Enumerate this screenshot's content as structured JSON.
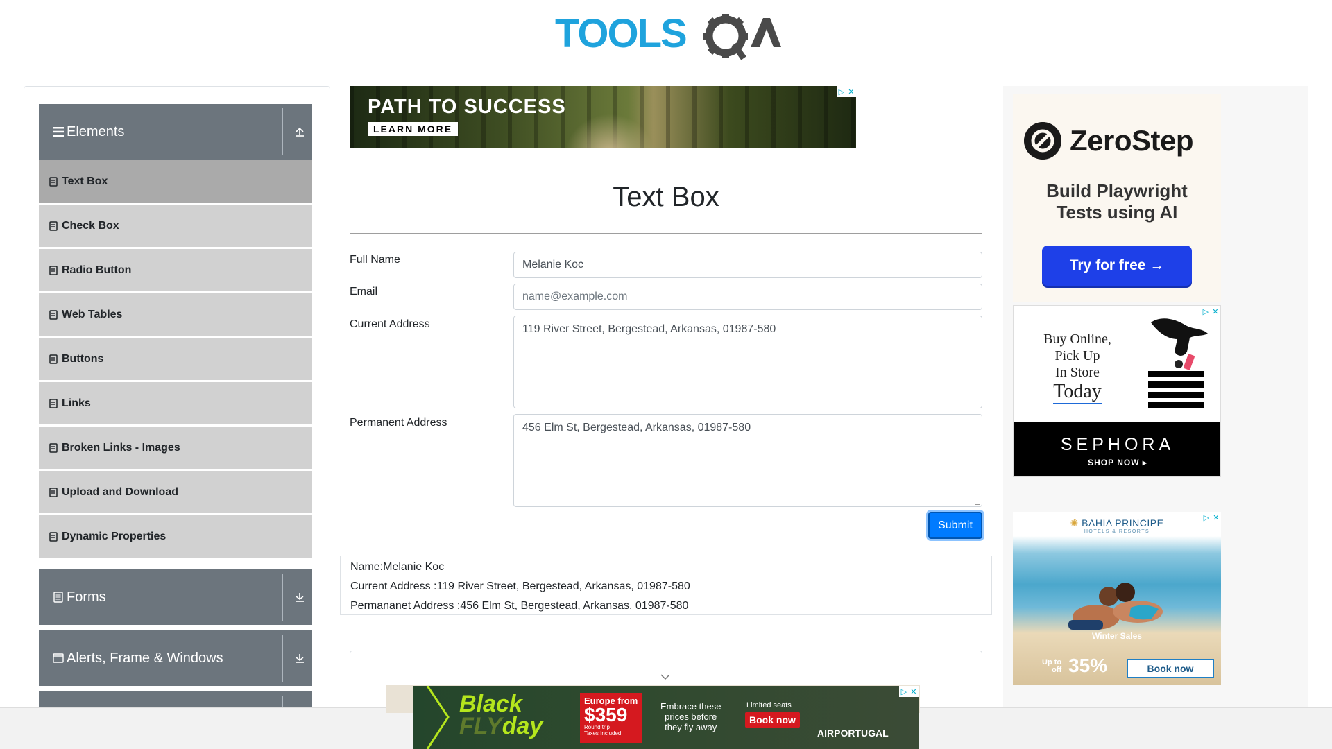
{
  "header": {
    "logo_tools": "TOOLS",
    "logo_qa": "QA"
  },
  "sidebar": {
    "groups": [
      {
        "title": "Elements",
        "icon": "hamburger-icon",
        "expanded": true
      },
      {
        "title": "Forms",
        "icon": "document-icon",
        "expanded": false
      },
      {
        "title": "Alerts, Frame & Windows",
        "icon": "window-icon",
        "expanded": false
      }
    ],
    "items": [
      {
        "label": "Text Box",
        "active": true
      },
      {
        "label": "Check Box"
      },
      {
        "label": "Radio Button"
      },
      {
        "label": "Web Tables"
      },
      {
        "label": "Buttons"
      },
      {
        "label": "Links"
      },
      {
        "label": "Broken Links - Images"
      },
      {
        "label": "Upload and Download"
      },
      {
        "label": "Dynamic Properties"
      }
    ]
  },
  "ads": {
    "top": {
      "title": "PATH TO SUCCESS",
      "button": "LEARN MORE"
    },
    "zerostep": {
      "brand": "ZeroStep",
      "tagline_1": "Build Playwright",
      "tagline_2": "Tests using AI",
      "cta": "Try for free →"
    },
    "sephora": {
      "line1": "Buy Online,",
      "line2": "Pick Up",
      "line3": "In Store",
      "line4": "Today",
      "brand": "SEPHORA",
      "cta": "SHOP NOW ▸"
    },
    "bahia": {
      "brand": "BAHIA PRINCIPE",
      "sub": "HOTELS & RESORTS",
      "sale": "Winter Sales",
      "upto_1": "Up to",
      "upto_2": "off",
      "pct": "35%",
      "cta": "Book now"
    },
    "bottom": {
      "black": "Black",
      "fly": "FLY",
      "day": "day",
      "price_from": "Europe from",
      "price": "$359",
      "price_note": "Round trip",
      "price_note_2": "Taxes Included",
      "msg_1": "Embrace these",
      "msg_2": "prices before",
      "msg_3": "they fly away",
      "limited": "Limited seats",
      "book": "Book now",
      "airline": "AIRPORTUGAL"
    }
  },
  "main": {
    "title": "Text Box",
    "form": {
      "full_name_label": "Full Name",
      "full_name_value": "Melanie Koc",
      "email_label": "Email",
      "email_placeholder": "name@example.com",
      "current_address_label": "Current Address",
      "current_address_value": "119 River Street, Bergestead, Arkansas, 01987-580",
      "permanent_address_label": "Permanent Address",
      "permanent_address_value": "456 Elm St, Bergestead, Arkansas, 01987-580",
      "submit_label": "Submit"
    },
    "output": {
      "name": "Name:Melanie Koc",
      "current": "Current Address :119 River Street, Bergestead, Arkansas, 01987-580",
      "permanent": "Permananet Address :456 Elm St, Bergestead, Arkansas, 01987-580"
    }
  },
  "colors": {
    "primary": "#007bff",
    "sidebar_header": "#6c757d",
    "menu_item": "#d1d1d1",
    "menu_active": "#aaaaaa",
    "logo_blue": "#1fa3dd",
    "logo_dark": "#4a4a4a"
  }
}
